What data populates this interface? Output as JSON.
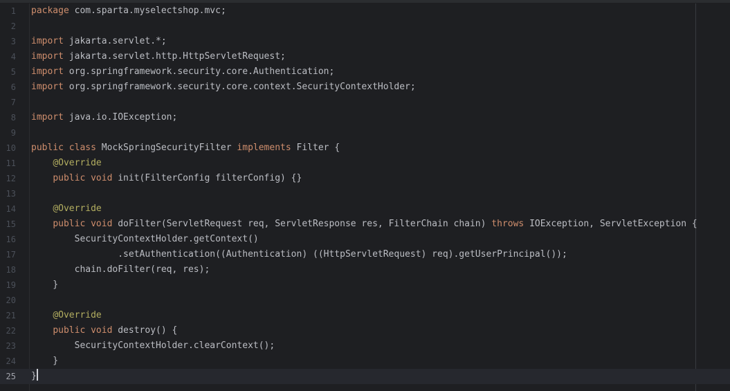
{
  "editor": {
    "current_line": 25,
    "lines": [
      {
        "num": "1",
        "tokens": [
          {
            "t": "package",
            "c": "kw"
          },
          {
            "t": " com.sparta.myselectshop.mvc;",
            "c": ""
          }
        ]
      },
      {
        "num": "2",
        "tokens": []
      },
      {
        "num": "3",
        "tokens": [
          {
            "t": "import",
            "c": "kw"
          },
          {
            "t": " jakarta.servlet.*;",
            "c": ""
          }
        ]
      },
      {
        "num": "4",
        "tokens": [
          {
            "t": "import",
            "c": "kw"
          },
          {
            "t": " jakarta.servlet.http.HttpServletRequest;",
            "c": ""
          }
        ]
      },
      {
        "num": "5",
        "tokens": [
          {
            "t": "import",
            "c": "kw"
          },
          {
            "t": " org.springframework.security.core.Authentication;",
            "c": ""
          }
        ]
      },
      {
        "num": "6",
        "tokens": [
          {
            "t": "import",
            "c": "kw"
          },
          {
            "t": " org.springframework.security.core.context.SecurityContextHolder;",
            "c": ""
          }
        ]
      },
      {
        "num": "7",
        "tokens": []
      },
      {
        "num": "8",
        "tokens": [
          {
            "t": "import",
            "c": "kw"
          },
          {
            "t": " java.io.IOException;",
            "c": ""
          }
        ]
      },
      {
        "num": "9",
        "tokens": []
      },
      {
        "num": "10",
        "tokens": [
          {
            "t": "public class",
            "c": "kw"
          },
          {
            "t": " MockSpringSecurityFilter ",
            "c": ""
          },
          {
            "t": "implements",
            "c": "kw"
          },
          {
            "t": " Filter {",
            "c": ""
          }
        ]
      },
      {
        "num": "11",
        "tokens": [
          {
            "t": "    ",
            "c": ""
          },
          {
            "t": "@Override",
            "c": "ann"
          }
        ]
      },
      {
        "num": "12",
        "tokens": [
          {
            "t": "    ",
            "c": ""
          },
          {
            "t": "public void",
            "c": "kw"
          },
          {
            "t": " init(FilterConfig filterConfig) {}",
            "c": ""
          }
        ]
      },
      {
        "num": "13",
        "tokens": []
      },
      {
        "num": "14",
        "tokens": [
          {
            "t": "    ",
            "c": ""
          },
          {
            "t": "@Override",
            "c": "ann"
          }
        ]
      },
      {
        "num": "15",
        "tokens": [
          {
            "t": "    ",
            "c": ""
          },
          {
            "t": "public void",
            "c": "kw"
          },
          {
            "t": " doFilter(ServletRequest req, ServletResponse res, FilterChain chain) ",
            "c": ""
          },
          {
            "t": "throws",
            "c": "kw"
          },
          {
            "t": " IOException, ServletException {",
            "c": ""
          }
        ]
      },
      {
        "num": "16",
        "tokens": [
          {
            "t": "        SecurityContextHolder.getContext()",
            "c": ""
          }
        ]
      },
      {
        "num": "17",
        "tokens": [
          {
            "t": "                .setAuthentication((Authentication) ((HttpServletRequest) req).getUserPrincipal());",
            "c": ""
          }
        ]
      },
      {
        "num": "18",
        "tokens": [
          {
            "t": "        chain.doFilter(req, res);",
            "c": ""
          }
        ]
      },
      {
        "num": "19",
        "tokens": [
          {
            "t": "    }",
            "c": ""
          }
        ]
      },
      {
        "num": "20",
        "tokens": []
      },
      {
        "num": "21",
        "tokens": [
          {
            "t": "    ",
            "c": ""
          },
          {
            "t": "@Override",
            "c": "ann"
          }
        ]
      },
      {
        "num": "22",
        "tokens": [
          {
            "t": "    ",
            "c": ""
          },
          {
            "t": "public void",
            "c": "kw"
          },
          {
            "t": " destroy() {",
            "c": ""
          }
        ]
      },
      {
        "num": "23",
        "tokens": [
          {
            "t": "        SecurityContextHolder.clearContext();",
            "c": ""
          }
        ]
      },
      {
        "num": "24",
        "tokens": [
          {
            "t": "    }",
            "c": ""
          }
        ]
      },
      {
        "num": "25",
        "tokens": [
          {
            "t": "}",
            "c": ""
          }
        ]
      }
    ]
  }
}
